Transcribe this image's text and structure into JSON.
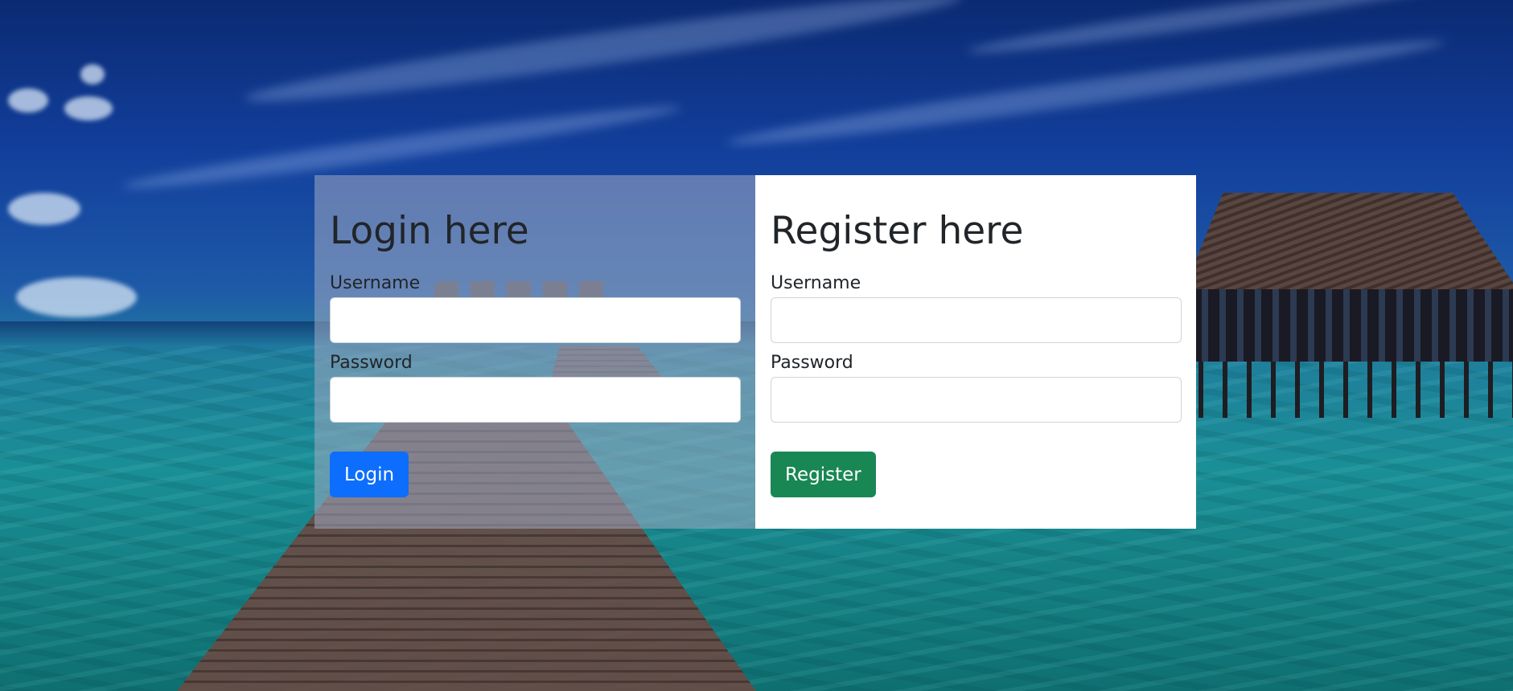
{
  "login": {
    "title": "Login here",
    "username_label": "Username",
    "username_value": "",
    "password_label": "Password",
    "password_value": "",
    "button_label": "Login",
    "button_color": "#0d6efd"
  },
  "register": {
    "title": "Register here",
    "username_label": "Username",
    "username_value": "",
    "password_label": "Password",
    "password_value": "",
    "button_label": "Register",
    "button_color": "#198754"
  },
  "background": {
    "description_colors": {
      "sky": "#123f9c",
      "water": "#1a8f96"
    }
  }
}
